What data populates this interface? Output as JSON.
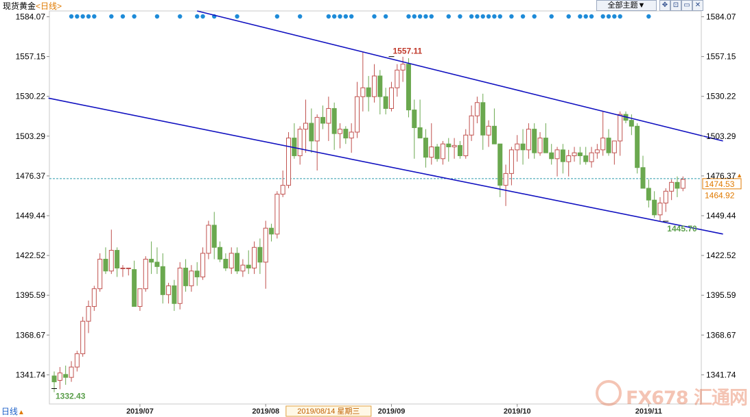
{
  "header": {
    "title": "现货黄金",
    "period": "<日线>",
    "theme_button": "全部主题▼"
  },
  "toolbar_icons": [
    "move-icon",
    "restore-icon",
    "window-icon",
    "close-icon"
  ],
  "footer": {
    "period_selector": "日线",
    "period_arrow": "▲"
  },
  "watermark": {
    "text": "FX678 汇通网"
  },
  "colors": {
    "up": "#c0504d",
    "down": "#6aa84f",
    "channel": "#1010c0",
    "markers": "#1e8bd8",
    "current_price_line": "#2a9aaa",
    "price_tag": "#e07a00"
  },
  "chart_data": {
    "type": "candlestick",
    "instrument": "现货黄金",
    "period": "日线",
    "y_axis": {
      "ticks": [
        1584.07,
        1557.15,
        1530.22,
        1503.29,
        1476.37,
        1449.44,
        1422.52,
        1395.59,
        1368.67,
        1341.74
      ],
      "ylim": [
        1322,
        1588
      ]
    },
    "x_axis": {
      "ticks": [
        {
          "label": "2019/07",
          "index": 15
        },
        {
          "label": "2019/08",
          "index": 37
        },
        {
          "label": "2019/09",
          "index": 59
        },
        {
          "label": "2019/10",
          "index": 81
        },
        {
          "label": "2019/11",
          "index": 104
        }
      ]
    },
    "crosshair_label": "2019/08/14  星期三",
    "crosshair_index": 48,
    "annotations": [
      {
        "text": "1557.11",
        "index": 59,
        "value": 1557.11,
        "kind": "high"
      },
      {
        "text": "1332.43",
        "index": 0,
        "value": 1332.43,
        "kind": "low"
      },
      {
        "text": "1445.70",
        "index": 107,
        "value": 1445.7,
        "kind": "low"
      }
    ],
    "current_price": {
      "value": 1474.53,
      "label": "1474.53"
    },
    "price_tag_2": {
      "value": 1464.92,
      "label": "1464.92"
    },
    "channel_lines": [
      {
        "points": [
          [
            25,
            1588
          ],
          [
            117,
            1500
          ]
        ]
      },
      {
        "points": [
          [
            -1,
            1529
          ],
          [
            117,
            1437
          ]
        ]
      }
    ],
    "event_marker_indices": [
      3,
      4,
      5,
      6,
      7,
      10,
      12,
      14,
      18,
      22,
      25,
      26,
      28,
      32,
      39,
      43,
      48,
      49,
      50,
      51,
      52,
      56,
      58,
      62,
      63,
      64,
      65,
      66,
      69,
      71,
      73,
      74,
      75,
      76,
      77,
      78,
      80,
      82,
      84,
      87,
      90,
      92,
      93,
      94,
      96,
      97,
      98,
      99,
      104
    ],
    "candles": [
      [
        1341,
        1344,
        1330,
        1337
      ],
      [
        1338,
        1347,
        1332,
        1343
      ],
      [
        1342,
        1348,
        1335,
        1340
      ],
      [
        1340,
        1351,
        1337,
        1347
      ],
      [
        1347,
        1358,
        1344,
        1356
      ],
      [
        1356,
        1381,
        1354,
        1378
      ],
      [
        1378,
        1392,
        1370,
        1388
      ],
      [
        1388,
        1402,
        1385,
        1400
      ],
      [
        1400,
        1424,
        1398,
        1420
      ],
      [
        1420,
        1428,
        1410,
        1412
      ],
      [
        1412,
        1440,
        1410,
        1426
      ],
      [
        1426,
        1428,
        1408,
        1414
      ],
      [
        1414,
        1416,
        1408,
        1414
      ],
      [
        1414,
        1414,
        1409,
        1414
      ],
      [
        1413,
        1419,
        1390,
        1388
      ],
      [
        1388,
        1396,
        1385,
        1400
      ],
      [
        1400,
        1422,
        1398,
        1420
      ],
      [
        1420,
        1432,
        1410,
        1418
      ],
      [
        1418,
        1428,
        1410,
        1415
      ],
      [
        1415,
        1424,
        1390,
        1396
      ],
      [
        1396,
        1404,
        1390,
        1402
      ],
      [
        1402,
        1406,
        1385,
        1390
      ],
      [
        1390,
        1418,
        1386,
        1414
      ],
      [
        1414,
        1420,
        1398,
        1402
      ],
      [
        1402,
        1416,
        1398,
        1412
      ],
      [
        1412,
        1418,
        1402,
        1408
      ],
      [
        1408,
        1428,
        1406,
        1424
      ],
      [
        1424,
        1446,
        1420,
        1443
      ],
      [
        1443,
        1452,
        1420,
        1428
      ],
      [
        1428,
        1432,
        1418,
        1420
      ],
      [
        1420,
        1424,
        1412,
        1414
      ],
      [
        1414,
        1428,
        1410,
        1424
      ],
      [
        1424,
        1428,
        1410,
        1412
      ],
      [
        1412,
        1420,
        1408,
        1416
      ],
      [
        1416,
        1426,
        1410,
        1414
      ],
      [
        1414,
        1432,
        1410,
        1428
      ],
      [
        1428,
        1434,
        1410,
        1418
      ],
      [
        1418,
        1446,
        1400,
        1441
      ],
      [
        1441,
        1444,
        1432,
        1437
      ],
      [
        1437,
        1466,
        1434,
        1464
      ],
      [
        1464,
        1480,
        1462,
        1470
      ],
      [
        1470,
        1506,
        1468,
        1502
      ],
      [
        1502,
        1512,
        1488,
        1490
      ],
      [
        1490,
        1510,
        1484,
        1508
      ],
      [
        1508,
        1528,
        1492,
        1512
      ],
      [
        1512,
        1522,
        1492,
        1500
      ],
      [
        1500,
        1518,
        1480,
        1516
      ],
      [
        1516,
        1524,
        1508,
        1512
      ],
      [
        1512,
        1530,
        1500,
        1522
      ],
      [
        1522,
        1526,
        1494,
        1505
      ],
      [
        1505,
        1512,
        1495,
        1508
      ],
      [
        1508,
        1510,
        1498,
        1502
      ],
      [
        1502,
        1512,
        1492,
        1506
      ],
      [
        1506,
        1540,
        1502,
        1530
      ],
      [
        1530,
        1560,
        1520,
        1536
      ],
      [
        1536,
        1544,
        1520,
        1530
      ],
      [
        1530,
        1552,
        1526,
        1544
      ],
      [
        1544,
        1548,
        1518,
        1530
      ],
      [
        1530,
        1536,
        1518,
        1522
      ],
      [
        1522,
        1540,
        1520,
        1536
      ],
      [
        1536,
        1552,
        1530,
        1548
      ],
      [
        1548,
        1557,
        1540,
        1552
      ],
      [
        1552,
        1556,
        1516,
        1521
      ],
      [
        1521,
        1528,
        1488,
        1509
      ],
      [
        1509,
        1528,
        1502,
        1502
      ],
      [
        1502,
        1508,
        1482,
        1489
      ],
      [
        1489,
        1512,
        1484,
        1496
      ],
      [
        1496,
        1498,
        1486,
        1488
      ],
      [
        1488,
        1500,
        1484,
        1498
      ],
      [
        1498,
        1502,
        1486,
        1496
      ],
      [
        1496,
        1502,
        1488,
        1497
      ],
      [
        1497,
        1500,
        1488,
        1490
      ],
      [
        1490,
        1508,
        1488,
        1504
      ],
      [
        1504,
        1524,
        1500,
        1517
      ],
      [
        1517,
        1530,
        1512,
        1526
      ],
      [
        1526,
        1532,
        1494,
        1504
      ],
      [
        1504,
        1514,
        1496,
        1510
      ],
      [
        1510,
        1522,
        1502,
        1498
      ],
      [
        1498,
        1496,
        1462,
        1470
      ],
      [
        1470,
        1484,
        1456,
        1478
      ],
      [
        1478,
        1496,
        1470,
        1494
      ],
      [
        1494,
        1504,
        1486,
        1498
      ],
      [
        1498,
        1508,
        1484,
        1494
      ],
      [
        1494,
        1512,
        1488,
        1508
      ],
      [
        1508,
        1512,
        1488,
        1492
      ],
      [
        1492,
        1506,
        1490,
        1502
      ],
      [
        1502,
        1512,
        1494,
        1492
      ],
      [
        1492,
        1498,
        1484,
        1488
      ],
      [
        1488,
        1496,
        1476,
        1494
      ],
      [
        1494,
        1498,
        1478,
        1486
      ],
      [
        1486,
        1494,
        1476,
        1490
      ],
      [
        1490,
        1496,
        1486,
        1492
      ],
      [
        1492,
        1496,
        1484,
        1490
      ],
      [
        1490,
        1496,
        1484,
        1486
      ],
      [
        1486,
        1496,
        1482,
        1492
      ],
      [
        1492,
        1498,
        1488,
        1494
      ],
      [
        1494,
        1520,
        1490,
        1502
      ],
      [
        1502,
        1508,
        1490,
        1492
      ],
      [
        1492,
        1498,
        1484,
        1500
      ],
      [
        1500,
        1520,
        1490,
        1518
      ],
      [
        1518,
        1520,
        1512,
        1514
      ],
      [
        1514,
        1518,
        1504,
        1510
      ],
      [
        1510,
        1512,
        1478,
        1482
      ],
      [
        1482,
        1490,
        1470,
        1468
      ],
      [
        1468,
        1474,
        1455,
        1460
      ],
      [
        1460,
        1466,
        1448,
        1450
      ],
      [
        1450,
        1462,
        1446,
        1458
      ],
      [
        1458,
        1468,
        1452,
        1466
      ],
      [
        1466,
        1474,
        1460,
        1472
      ],
      [
        1472,
        1476,
        1462,
        1468
      ],
      [
        1468,
        1476,
        1466,
        1474
      ]
    ]
  }
}
